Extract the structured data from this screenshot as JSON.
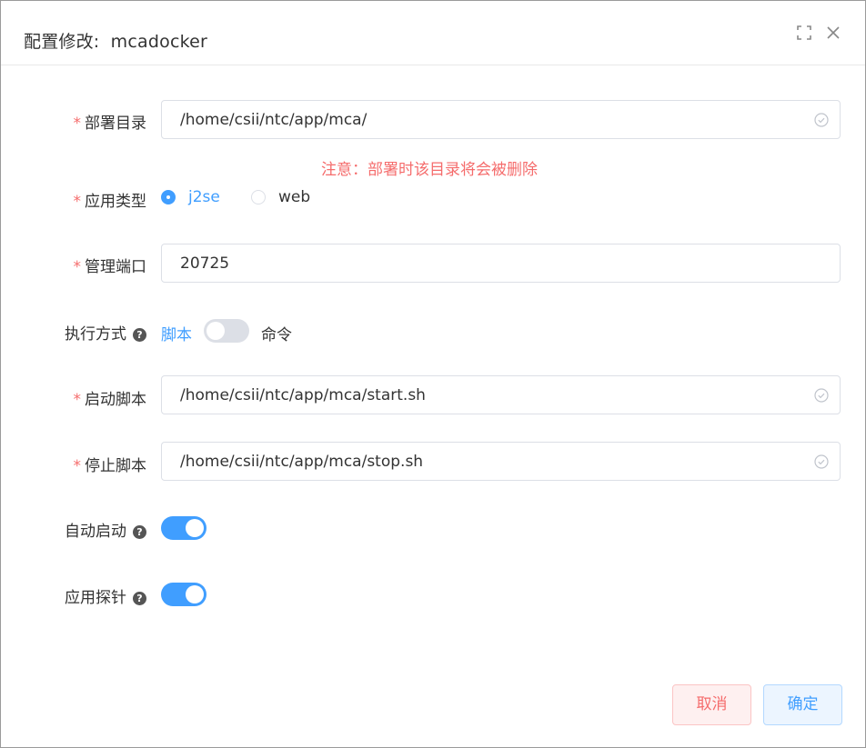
{
  "dialog": {
    "title_prefix": "配置修改:",
    "title_name": "mcadocker"
  },
  "form": {
    "deploy_dir": {
      "label": "部署目录",
      "required": true,
      "value": "/home/csii/ntc/app/mca/"
    },
    "warning": "注意：部署时该目录将会被删除",
    "app_type": {
      "label": "应用类型",
      "required": true,
      "options": [
        "j2se",
        "web"
      ],
      "selected": "j2se"
    },
    "mgmt_port": {
      "label": "管理端口",
      "required": true,
      "value": "20725"
    },
    "exec_mode": {
      "label": "执行方式",
      "help": "?",
      "left_text": "脚本",
      "right_text": "命令",
      "state": "off"
    },
    "start_script": {
      "label": "启动脚本",
      "required": true,
      "value": "/home/csii/ntc/app/mca/start.sh"
    },
    "stop_script": {
      "label": "停止脚本",
      "required": true,
      "value": "/home/csii/ntc/app/mca/stop.sh"
    },
    "auto_start": {
      "label": "自动启动",
      "help": "?",
      "state": "on"
    },
    "app_probe": {
      "label": "应用探针",
      "help": "?",
      "state": "on"
    }
  },
  "footer": {
    "cancel_label": "取消",
    "ok_label": "确定"
  },
  "colors": {
    "primary": "#409eff",
    "danger": "#f56c6c",
    "border": "#dcdfe6"
  },
  "icons": [
    "fullscreen-icon",
    "close-icon",
    "check-circle-icon",
    "help-icon"
  ]
}
